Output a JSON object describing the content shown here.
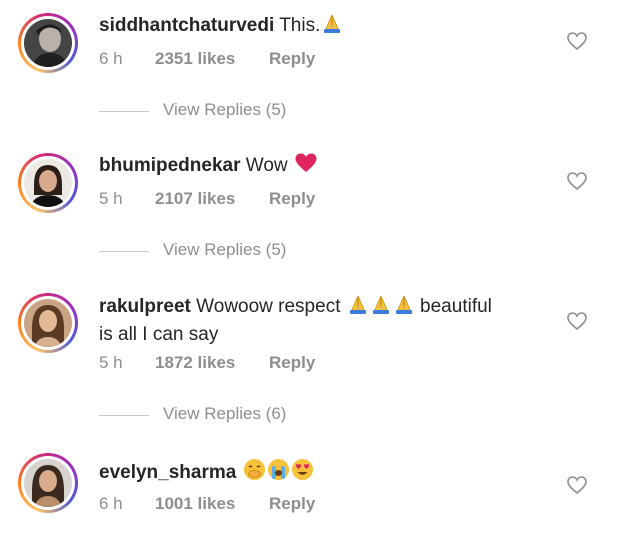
{
  "comments": [
    {
      "username": "siddhantchaturvedi",
      "text": "This.",
      "text_line2": "",
      "emojis": [
        "folded-hands"
      ],
      "time": "6 h",
      "likes": "2351 likes",
      "reply": "Reply",
      "view_replies": "View Replies (5)"
    },
    {
      "username": "bhumipednekar",
      "text": "Wow",
      "text_line2": "",
      "emojis": [
        "red-heart"
      ],
      "time": "5 h",
      "likes": "2107 likes",
      "reply": "Reply",
      "view_replies": "View Replies (5)"
    },
    {
      "username": "rakulpreet",
      "text": "Wowoow respect",
      "text_after_emojis": "beautiful",
      "text_line2": "is all I can say",
      "emojis": [
        "folded-hands",
        "folded-hands",
        "folded-hands"
      ],
      "time": "5 h",
      "likes": "1872 likes",
      "reply": "Reply",
      "view_replies": "View Replies (6)"
    },
    {
      "username": "evelyn_sharma",
      "text": "",
      "text_line2": "",
      "emojis": [
        "face-with-hand-over-mouth",
        "loudly-crying-face",
        "smiling-face-with-heart-eyes"
      ],
      "time": "6 h",
      "likes": "1001 likes",
      "reply": "Reply",
      "view_replies": ""
    }
  ],
  "colors": {
    "text": "#262626",
    "secondary": "#8e8e8e",
    "divider": "#c7c7c7",
    "heart": "#e0245e",
    "emoji_yellow": "#f7c23a"
  }
}
